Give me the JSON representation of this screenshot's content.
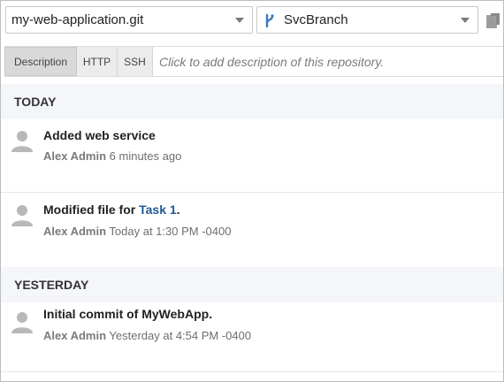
{
  "toolbar": {
    "repository": "my-web-application.git",
    "branch": "SvcBranch"
  },
  "tabs": {
    "description": "Description",
    "http": "HTTP",
    "ssh": "SSH",
    "description_placeholder": "Click to add description of this repository."
  },
  "feed": {
    "groups": [
      {
        "label": "TODAY",
        "entries": [
          {
            "title": "Added web service",
            "author": "Alex Admin",
            "time": "6 minutes ago"
          },
          {
            "title_prefix": "Modified file for ",
            "link": "Task 1",
            "title_suffix": ".",
            "author": "Alex Admin",
            "time": "Today at 1:30 PM -0400"
          }
        ]
      },
      {
        "label": "YESTERDAY",
        "entries": [
          {
            "title": "Initial commit of MyWebApp.",
            "author": "Alex Admin",
            "time": "Yesterday at 4:54 PM -0400"
          }
        ]
      }
    ]
  },
  "colors": {
    "link": "#1d5a93",
    "branch_icon": "#3b7bbf",
    "header_bg": "#f4f6fa"
  },
  "icons": {
    "branch": "git-branch-icon",
    "copy": "copy-icon",
    "avatar": "user-avatar-icon"
  }
}
